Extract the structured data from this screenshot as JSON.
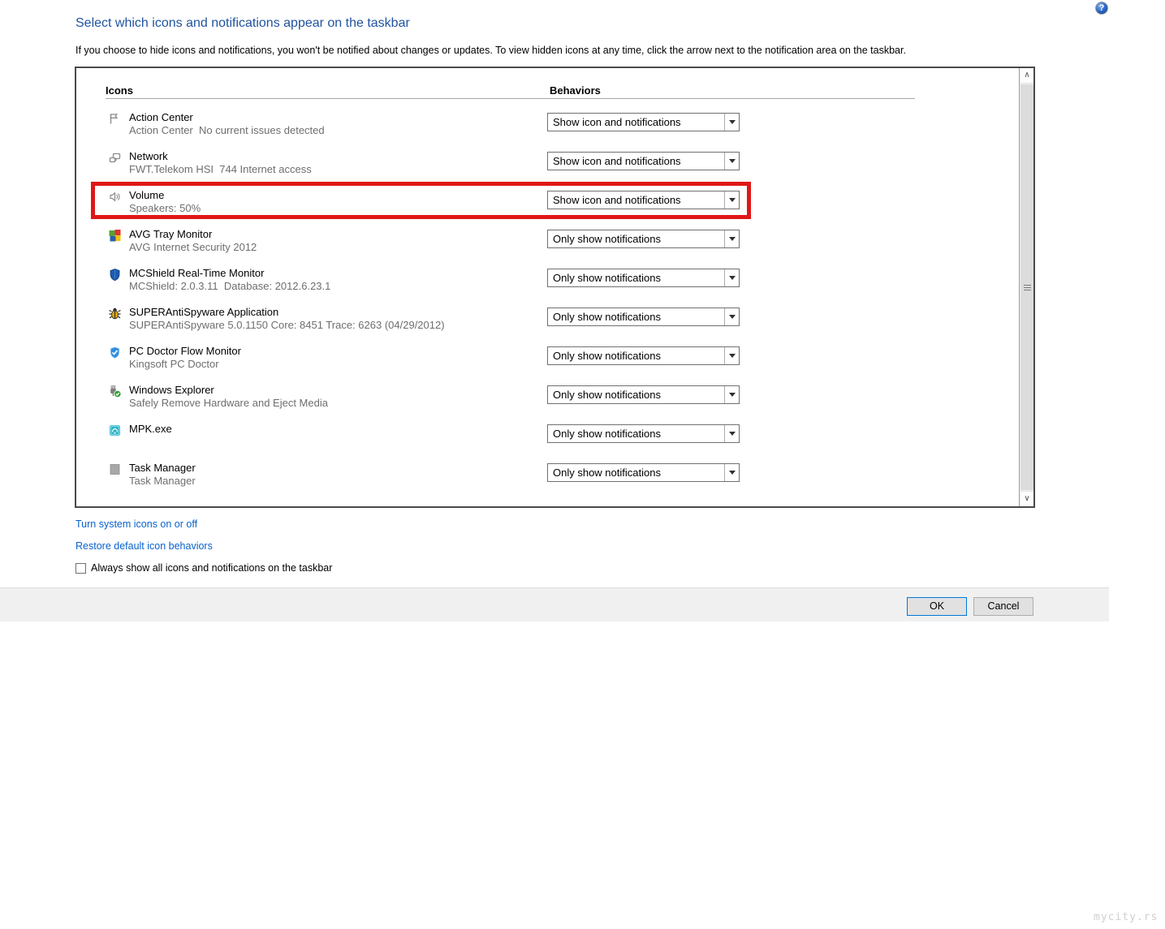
{
  "header": {
    "title": "Select which icons and notifications appear on the taskbar",
    "description": "If you choose to hide icons and notifications, you won't be notified about changes or updates. To view hidden icons at any time, click the arrow next to the notification area on the taskbar."
  },
  "list": {
    "columns": {
      "icons": "Icons",
      "behaviors": "Behaviors"
    },
    "items": [
      {
        "name": "Action Center",
        "description": "Action Center  No current issues detected",
        "behavior": "Show icon and notifications",
        "icon": "flag-icon",
        "highlighted": false
      },
      {
        "name": "Network",
        "description": "FWT.Telekom HSI  744 Internet access",
        "behavior": "Show icon and notifications",
        "icon": "network-icon",
        "highlighted": false
      },
      {
        "name": "Volume",
        "description": "Speakers: 50%",
        "behavior": "Show icon and notifications",
        "icon": "speaker-icon",
        "highlighted": true
      },
      {
        "name": "AVG Tray Monitor",
        "description": "AVG Internet Security 2012",
        "behavior": "Only show notifications",
        "icon": "avg-icon",
        "highlighted": false
      },
      {
        "name": "MCShield Real-Time Monitor",
        "description": "MCShield: 2.0.3.11  Database: 2012.6.23.1",
        "behavior": "Only show notifications",
        "icon": "shield-icon",
        "highlighted": false
      },
      {
        "name": "SUPERAntiSpyware Application",
        "description": "SUPERAntiSpyware 5.0.1150 Core: 8451 Trace: 6263 (04/29/2012)",
        "behavior": "Only show notifications",
        "icon": "bug-icon",
        "highlighted": false
      },
      {
        "name": "PC Doctor Flow Monitor",
        "description": "Kingsoft PC Doctor",
        "behavior": "Only show notifications",
        "icon": "shield-check-icon",
        "highlighted": false
      },
      {
        "name": "Windows Explorer",
        "description": "Safely Remove Hardware and Eject Media",
        "behavior": "Only show notifications",
        "icon": "usb-eject-icon",
        "highlighted": false
      },
      {
        "name": "MPK.exe",
        "description": "",
        "behavior": "Only show notifications",
        "icon": "mpk-icon",
        "highlighted": false
      },
      {
        "name": "Task Manager",
        "description": "Task Manager",
        "behavior": "Only show notifications",
        "icon": "task-manager-icon",
        "highlighted": false
      }
    ]
  },
  "links": {
    "turn_system_icons": "Turn system icons on or off",
    "restore_defaults": "Restore default icon behaviors"
  },
  "checkbox": {
    "label": "Always show all icons and notifications on the taskbar",
    "checked": false
  },
  "footer": {
    "ok_label": "OK",
    "cancel_label": "Cancel"
  },
  "help_icon_glyph": "?",
  "watermark": "mycity.rs",
  "colors": {
    "title_blue": "#20549f",
    "link_blue": "#0762cc",
    "highlight_red": "#e01717",
    "default_button_border": "#0078d7",
    "muted_text": "#6e6e6e"
  }
}
